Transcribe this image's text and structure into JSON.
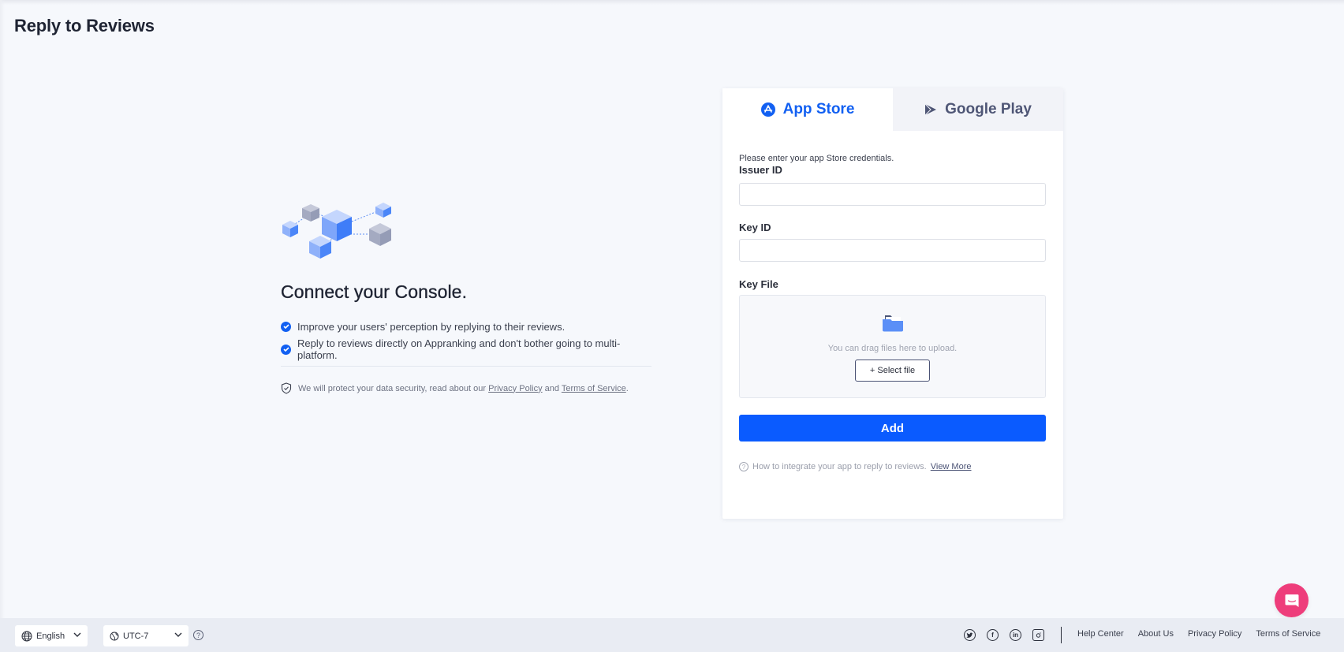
{
  "page": {
    "title": "Reply to Reviews"
  },
  "intro": {
    "illustration": "network-cubes-illustration",
    "heading": "Connect your Console.",
    "bullets": [
      "Improve your users' perception by replying to their reviews.",
      "Reply to reviews directly on Appranking and don't bother going to multi-platform."
    ],
    "security": {
      "prefix": "We will protect your data security, read about our ",
      "privacy_link": "Privacy Policy",
      "and": " and ",
      "terms_link": "Terms of Service",
      "suffix": "."
    }
  },
  "card": {
    "tabs": [
      {
        "label": "App Store",
        "icon": "app-store-icon",
        "active": true
      },
      {
        "label": "Google Play",
        "icon": "google-play-icon",
        "active": false
      }
    ],
    "instructions": "Please enter your app Store credentials.",
    "fields": {
      "issuer_id": {
        "label": "Issuer ID",
        "value": "",
        "placeholder": ""
      },
      "key_id": {
        "label": "Key ID",
        "value": "",
        "placeholder": ""
      },
      "key_file": {
        "label": "Key File",
        "hint": "You can drag files here to upload.",
        "select_label": "+ Select file"
      }
    },
    "add_label": "Add",
    "help": {
      "text": "How to integrate your app to reply to reviews.",
      "link": "View More"
    }
  },
  "footer": {
    "language": "English",
    "timezone": "UTC-7",
    "socials": [
      "twitter",
      "facebook",
      "linkedin",
      "instagram"
    ],
    "links": [
      "Help Center",
      "About Us",
      "Privacy Policy",
      "Terms of Service"
    ]
  },
  "colors": {
    "accent": "#0a5bff",
    "tab_active": "#1260f2",
    "tab_inactive": "#4f5676",
    "chat": "#ee3d7b",
    "background": "#f6f8fc"
  }
}
